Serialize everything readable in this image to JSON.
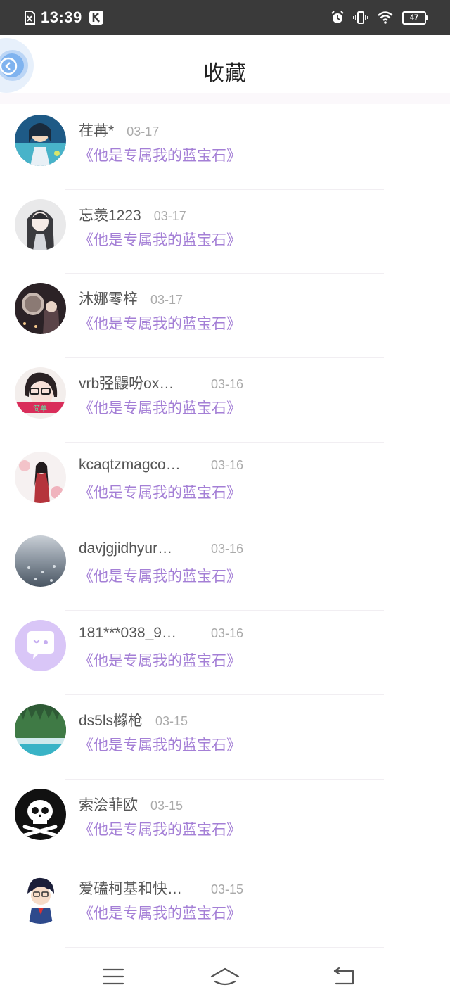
{
  "status_bar": {
    "time": "13:39",
    "battery": "47",
    "icons": [
      "sim-x-icon",
      "k-app-icon",
      "alarm-icon",
      "vibrate-icon",
      "wifi-icon",
      "battery-icon"
    ]
  },
  "header": {
    "title": "收藏",
    "back_icon": "chevron-left-icon",
    "float_icon": "close-circle-icon"
  },
  "list": [
    {
      "name": "荏苒*",
      "date": "03-17",
      "book": "《他是专属我的蓝宝石》"
    },
    {
      "name": "忘羡1223",
      "date": "03-17",
      "book": "《他是专属我的蓝宝石》"
    },
    {
      "name": "沐娜零梓",
      "date": "03-17",
      "book": "《他是专属我的蓝宝石》"
    },
    {
      "name": "vrb弪鼹吩ox…",
      "date": "03-16",
      "book": "《他是专属我的蓝宝石》"
    },
    {
      "name": "kcaqtzmagco…",
      "date": "03-16",
      "book": "《他是专属我的蓝宝石》"
    },
    {
      "name": "davjgjidhyur…",
      "date": "03-16",
      "book": "《他是专属我的蓝宝石》"
    },
    {
      "name": "181***038_9…",
      "date": "03-16",
      "book": "《他是专属我的蓝宝石》"
    },
    {
      "name": "ds5ls橼枪",
      "date": "03-15",
      "book": "《他是专属我的蓝宝石》"
    },
    {
      "name": "索浍菲欧",
      "date": "03-15",
      "book": "《他是专属我的蓝宝石》"
    },
    {
      "name": "爱磕柯基和快…",
      "date": "03-15",
      "book": "《他是专属我的蓝宝石》"
    }
  ],
  "nav_bar": {
    "icons": [
      "menu-icon",
      "home-icon",
      "back-icon"
    ]
  },
  "colors": {
    "status_bar_bg": "#3a3a3a",
    "book_title": "#a47fd6",
    "date": "#aaaaaa",
    "username": "#555555",
    "accent_blue": "#4a90e2"
  }
}
